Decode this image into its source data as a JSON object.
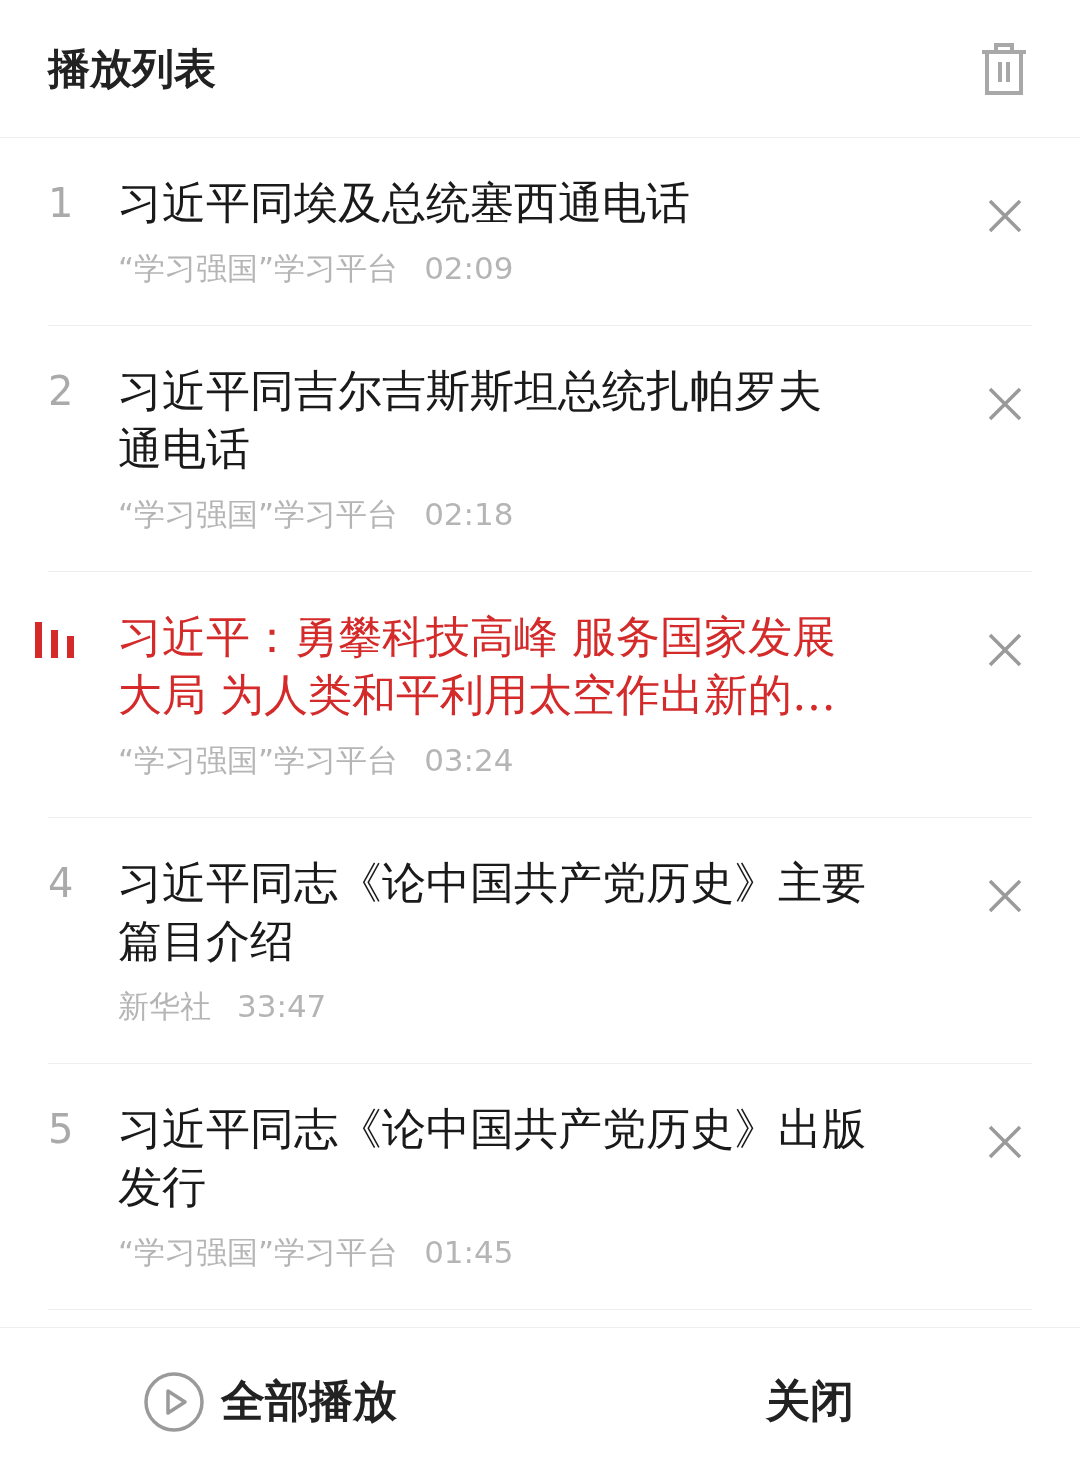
{
  "header": {
    "title": "播放列表"
  },
  "items": [
    {
      "number": "1",
      "title_lines": [
        "习近平同埃及总统塞西通电话"
      ],
      "source": "“学习强国”学习平台",
      "duration": "02:09",
      "selected": false
    },
    {
      "number": "2",
      "title_lines": [
        "习近平同吉尔吉斯斯坦总统扎帕罗夫",
        "通电话"
      ],
      "source": "“学习强国”学习平台",
      "duration": "02:18",
      "selected": false
    },
    {
      "title_lines": [
        "习近平：勇攀科技高峰 服务国家发展",
        "大局 为人类和平利用太空作出新的…"
      ],
      "source": "“学习强国”学习平台",
      "duration": "03:24",
      "selected": true
    },
    {
      "number": "4",
      "title_lines": [
        "习近平同志《论中国共产党历史》主要",
        "篇目介绍"
      ],
      "source": "新华社",
      "duration": "33:47",
      "selected": false
    },
    {
      "number": "5",
      "title_lines": [
        "习近平同志《论中国共产党历史》出版",
        "发行"
      ],
      "source": "“学习强国”学习平台",
      "duration": "01:45",
      "selected": false
    }
  ],
  "footer": {
    "play_all": "全部播放",
    "close": "关闭"
  }
}
